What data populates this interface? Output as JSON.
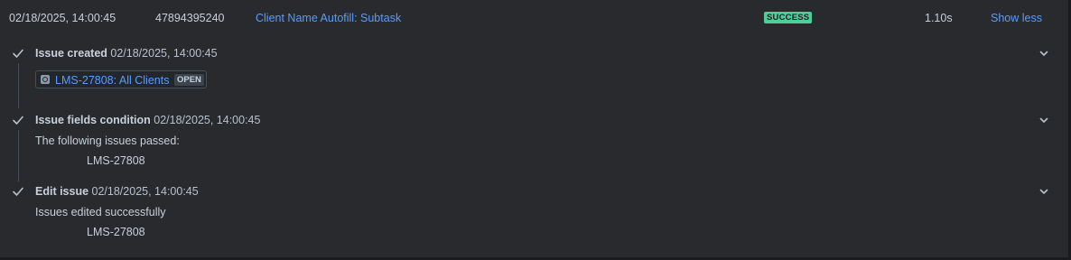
{
  "header": {
    "datetime": "02/18/2025, 14:00:45",
    "rule_id": "47894395240",
    "rule_name": "Client Name Autofill: Subtask",
    "status": "SUCCESS",
    "duration": "1.10s",
    "toggle_label": "Show less"
  },
  "steps": [
    {
      "title": "Issue created",
      "time": "02/18/2025, 14:00:45",
      "issue": {
        "key_label": "LMS-27808: All Clients",
        "status": "OPEN",
        "type_icon": "story-icon"
      }
    },
    {
      "title": "Issue fields condition",
      "time": "02/18/2025, 14:00:45",
      "message": "The following issues passed:",
      "issue_key": "LMS-27808"
    },
    {
      "title": "Edit issue",
      "time": "02/18/2025, 14:00:45",
      "message": "Issues edited successfully",
      "issue_key": "LMS-27808"
    }
  ],
  "colors": {
    "background": "#282a2e",
    "link": "#579dff",
    "success": "#4bce97",
    "text": "#c7d1db"
  }
}
